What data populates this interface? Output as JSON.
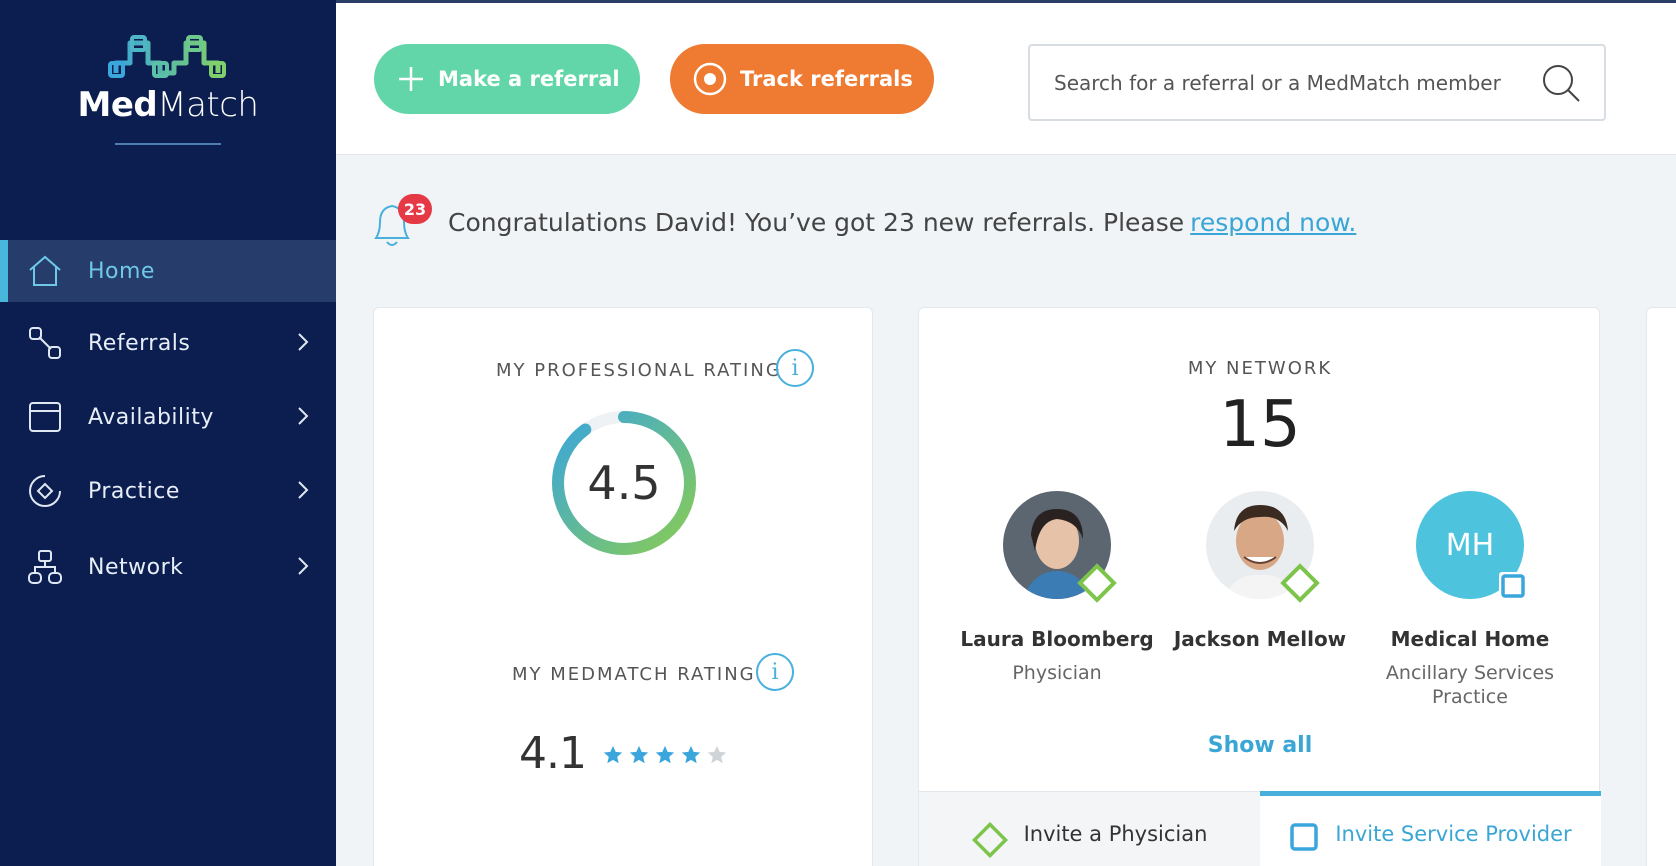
{
  "app": {
    "brand_prefix": "Med",
    "brand_suffix": "Match",
    "accent": "#49b0dc",
    "sidebar_bg": "#0b1e4f"
  },
  "sidebar": {
    "items": [
      {
        "label": "Home",
        "icon": "home-icon",
        "active": true
      },
      {
        "label": "Referrals",
        "icon": "referrals-icon"
      },
      {
        "label": "Availability",
        "icon": "calendar-icon"
      },
      {
        "label": "Practice",
        "icon": "practice-icon"
      },
      {
        "label": "Network",
        "icon": "network-icon"
      }
    ]
  },
  "header": {
    "make_referral": "Make a referral",
    "track_referrals": "Track referrals",
    "search_placeholder": "Search for a referral or a MedMatch member"
  },
  "notification": {
    "count": "23",
    "message": "Congratulations David! You’ve got 23 new referrals. Please",
    "link": "respond now."
  },
  "rating": {
    "professional_title": "MY PROFESSIONAL RATING",
    "professional_value": "4.5",
    "professional_fraction": 0.9,
    "medmatch_title": "MY MEDMATCH RATING",
    "medmatch_value": "4.1",
    "stars_filled": 4,
    "stars_total": 5
  },
  "network": {
    "title": "MY NETWORK",
    "count": "15",
    "members": [
      {
        "name": "Laura Bloomberg",
        "role": "Physician"
      },
      {
        "name": "Jackson Mellow",
        "role": ""
      },
      {
        "name": "Medical Home",
        "role_line1": "Ancillary Services",
        "role_line2": "Practice",
        "initials": "MH"
      }
    ],
    "show_all": "Show all",
    "invite_physician": "Invite a Physician",
    "invite_provider": "Invite Service Provider"
  }
}
